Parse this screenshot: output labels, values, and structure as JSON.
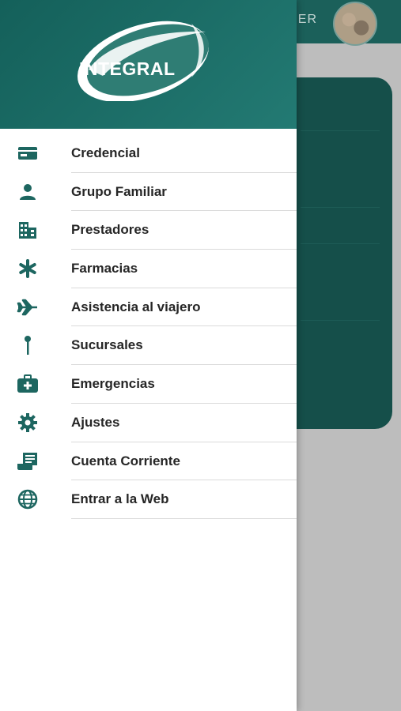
{
  "background": {
    "header_text": "IER"
  },
  "drawer": {
    "logo_text": "INTEGRAL",
    "items": [
      {
        "label": "Credencial",
        "icon": "id-card-icon"
      },
      {
        "label": "Grupo Familiar",
        "icon": "person-icon"
      },
      {
        "label": "Prestadores",
        "icon": "buildings-icon"
      },
      {
        "label": "Farmacias",
        "icon": "asterisk-icon"
      },
      {
        "label": "Asistencia al viajero",
        "icon": "airplane-icon"
      },
      {
        "label": "Sucursales",
        "icon": "map-pin-icon"
      },
      {
        "label": "Emergencias",
        "icon": "medical-kit-icon"
      },
      {
        "label": "Ajustes",
        "icon": "gear-icon"
      },
      {
        "label": "Cuenta Corriente",
        "icon": "receipt-icon"
      },
      {
        "label": "Entrar a la Web",
        "icon": "globe-icon"
      }
    ]
  },
  "colors": {
    "primary": "#1d6660",
    "icon": "#1d6660",
    "text": "#262626"
  }
}
